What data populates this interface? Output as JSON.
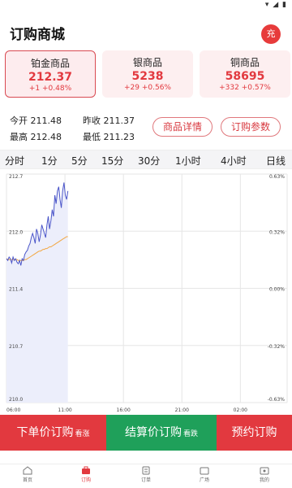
{
  "status_bar": {
    "icons": "▾ ◢ ▮"
  },
  "header": {
    "title": "订购商城",
    "charge_label": "充"
  },
  "products": [
    {
      "name": "铂金商品",
      "price": "212.37",
      "change": "+1 +0.48%"
    },
    {
      "name": "银商品",
      "price": "5238",
      "change": "+29 +0.56%"
    },
    {
      "name": "铜商品",
      "price": "58695",
      "change": "+332 +0.57%"
    }
  ],
  "stats": {
    "open": "今开 211.48",
    "prev_close": "昨收 211.37",
    "high": "最高 212.48",
    "low": "最低 211.23",
    "detail_button": "商品详情",
    "params_button": "订购参数"
  },
  "timeframes": [
    "分时",
    "1分",
    "5分",
    "15分",
    "30分",
    "1小时",
    "4小时",
    "日线"
  ],
  "chart_data": {
    "type": "line",
    "series": [
      {
        "values": [
          211.7,
          211.68,
          211.72,
          211.7,
          211.65,
          211.72,
          211.68,
          211.7,
          211.66,
          211.64,
          211.68,
          211.62,
          211.7,
          211.68,
          211.75,
          211.78,
          211.8,
          211.85,
          211.88,
          211.95,
          212.0,
          211.95,
          211.88,
          212.05,
          212.0,
          211.9,
          211.98,
          212.1,
          212.05,
          212.0,
          211.95,
          212.1,
          212.2,
          212.05,
          212.15,
          212.28,
          212.2,
          212.45,
          212.35,
          212.5,
          212.55,
          212.4,
          212.3,
          212.5,
          212.6,
          212.45,
          212.4,
          212.5
        ]
      },
      {
        "values": [
          211.7,
          211.69,
          211.69,
          211.69,
          211.69,
          211.69,
          211.69,
          211.69,
          211.69,
          211.68,
          211.68,
          211.68,
          211.68,
          211.68,
          211.69,
          211.69,
          211.7,
          211.71,
          211.72,
          211.73,
          211.74,
          211.75,
          211.76,
          211.77,
          211.78,
          211.79,
          211.79,
          211.8,
          211.81,
          211.81,
          211.82,
          211.82,
          211.83,
          211.84,
          211.84,
          211.85,
          211.86,
          211.87,
          211.88,
          211.89,
          211.9,
          211.91,
          211.92,
          211.93,
          211.94,
          211.95,
          211.96,
          211.96
        ]
      }
    ],
    "session": {
      "start": "06:00",
      "end": "06:00 (next day)",
      "data_end": "11:15"
    },
    "ylim": [
      210.0,
      212.7
    ],
    "y_ticks_left": [
      "212.7",
      "212.0",
      "211.4",
      "210.7",
      "210.0"
    ],
    "y_ticks_right": [
      "0.63%",
      "0.32%",
      "0.00%",
      "-0.32%",
      "-0.63%"
    ],
    "x_ticks": [
      "06:00",
      "11:00",
      "16:00",
      "21:00",
      "02:00"
    ],
    "colors": {
      "price_line": "#4a55c9",
      "avg_line": "#f2a640",
      "area": "#eceefb",
      "grid": "#e6e6e6"
    },
    "grid": true
  },
  "actions": {
    "buy_down": {
      "label": "下单价订购",
      "hint": "看涨",
      "color": "#e2393f"
    },
    "buy_settle": {
      "label": "结算价订购",
      "hint": "看跌",
      "color": "#1fa05a"
    },
    "reserve": {
      "label": "预约订购",
      "color": "#e2393f"
    }
  },
  "nav": [
    {
      "label": "首页",
      "icon": "home-icon"
    },
    {
      "label": "订购",
      "icon": "shop-icon",
      "active": true
    },
    {
      "label": "订单",
      "icon": "order-icon"
    },
    {
      "label": "广场",
      "icon": "square-icon"
    },
    {
      "label": "我的",
      "icon": "profile-icon"
    }
  ]
}
